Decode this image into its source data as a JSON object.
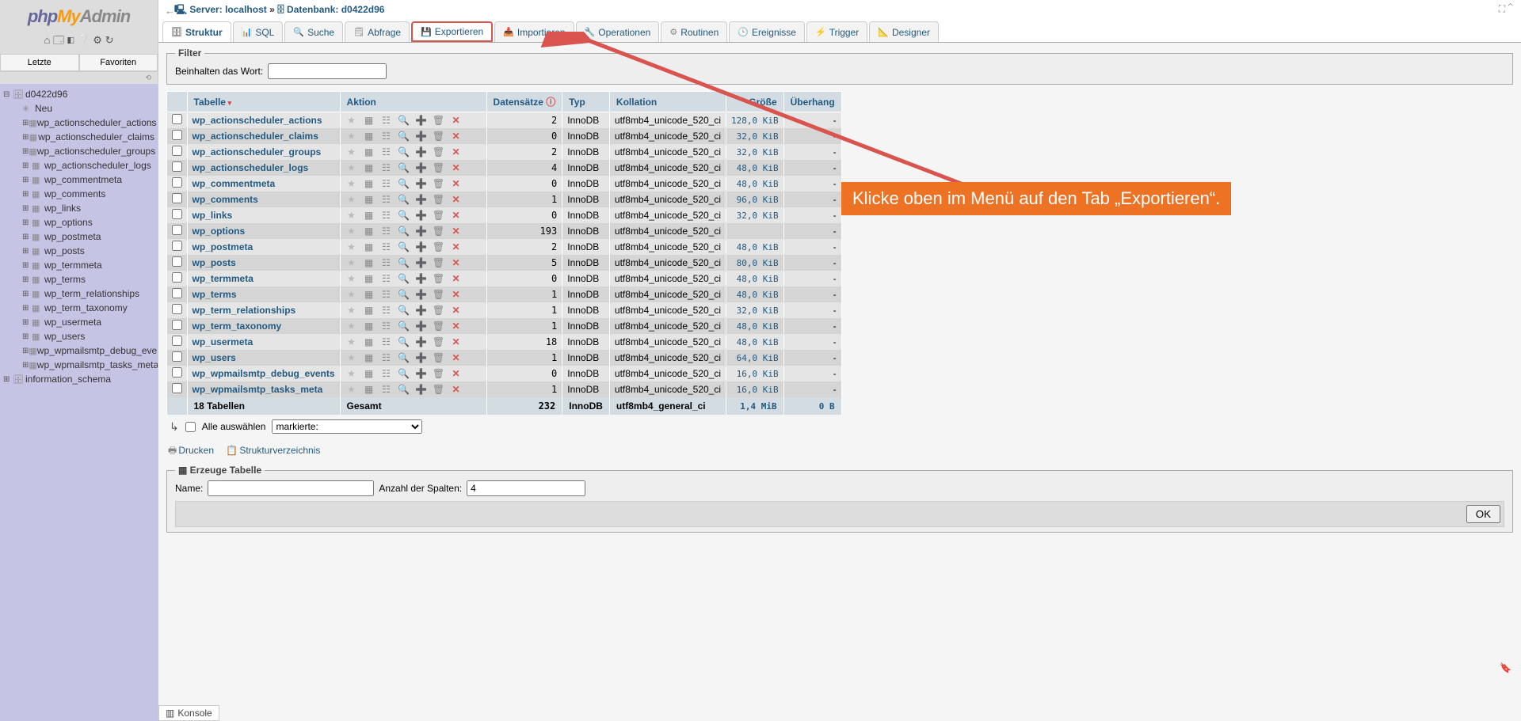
{
  "logo": {
    "p1": "php",
    "p2": "My",
    "p3": "Admin"
  },
  "sidebar_tabs": {
    "recent": "Letzte",
    "favorites": "Favoriten"
  },
  "tree": {
    "db": "d0422d96",
    "new": "Neu",
    "tables": [
      "wp_actionscheduler_actions",
      "wp_actionscheduler_claims",
      "wp_actionscheduler_groups",
      "wp_actionscheduler_logs",
      "wp_commentmeta",
      "wp_comments",
      "wp_links",
      "wp_options",
      "wp_postmeta",
      "wp_posts",
      "wp_termmeta",
      "wp_terms",
      "wp_term_relationships",
      "wp_term_taxonomy",
      "wp_usermeta",
      "wp_users",
      "wp_wpmailsmtp_debug_events",
      "wp_wpmailsmtp_tasks_meta"
    ],
    "info_schema": "information_schema"
  },
  "breadcrumb": {
    "server_label": "Server:",
    "server": "localhost",
    "sep": "»",
    "db_label": "Datenbank:",
    "db": "d0422d96"
  },
  "tabs": [
    "Struktur",
    "SQL",
    "Suche",
    "Abfrage",
    "Exportieren",
    "Importieren",
    "Operationen",
    "Routinen",
    "Ereignisse",
    "Trigger",
    "Designer"
  ],
  "tab_icons": [
    "🗄",
    "📊",
    "🔍",
    "🗒",
    "💾",
    "📥",
    "🔧",
    "⚙",
    "🕒",
    "⚡",
    "📐"
  ],
  "filter": {
    "legend": "Filter",
    "label": "Beinhalten das Wort:"
  },
  "headers": {
    "table": "Tabelle",
    "action": "Aktion",
    "rows": "Datensätze",
    "type": "Typ",
    "collation": "Kollation",
    "size": "Größe",
    "overhead": "Überhang"
  },
  "rows": [
    {
      "t": "wp_actionscheduler_actions",
      "r": "2",
      "e": "InnoDB",
      "c": "utf8mb4_unicode_520_ci",
      "s": "128,0 KiB",
      "o": "-"
    },
    {
      "t": "wp_actionscheduler_claims",
      "r": "0",
      "e": "InnoDB",
      "c": "utf8mb4_unicode_520_ci",
      "s": "32,0 KiB",
      "o": "-"
    },
    {
      "t": "wp_actionscheduler_groups",
      "r": "2",
      "e": "InnoDB",
      "c": "utf8mb4_unicode_520_ci",
      "s": "32,0 KiB",
      "o": "-"
    },
    {
      "t": "wp_actionscheduler_logs",
      "r": "4",
      "e": "InnoDB",
      "c": "utf8mb4_unicode_520_ci",
      "s": "48,0 KiB",
      "o": "-"
    },
    {
      "t": "wp_commentmeta",
      "r": "0",
      "e": "InnoDB",
      "c": "utf8mb4_unicode_520_ci",
      "s": "48,0 KiB",
      "o": "-"
    },
    {
      "t": "wp_comments",
      "r": "1",
      "e": "InnoDB",
      "c": "utf8mb4_unicode_520_ci",
      "s": "96,0 KiB",
      "o": "-"
    },
    {
      "t": "wp_links",
      "r": "0",
      "e": "InnoDB",
      "c": "utf8mb4_unicode_520_ci",
      "s": "32,0 KiB",
      "o": "-"
    },
    {
      "t": "wp_options",
      "r": "193",
      "e": "InnoDB",
      "c": "utf8mb4_unicode_520_ci",
      "s": "",
      "o": "-"
    },
    {
      "t": "wp_postmeta",
      "r": "2",
      "e": "InnoDB",
      "c": "utf8mb4_unicode_520_ci",
      "s": "48,0 KiB",
      "o": "-"
    },
    {
      "t": "wp_posts",
      "r": "5",
      "e": "InnoDB",
      "c": "utf8mb4_unicode_520_ci",
      "s": "80,0 KiB",
      "o": "-"
    },
    {
      "t": "wp_termmeta",
      "r": "0",
      "e": "InnoDB",
      "c": "utf8mb4_unicode_520_ci",
      "s": "48,0 KiB",
      "o": "-"
    },
    {
      "t": "wp_terms",
      "r": "1",
      "e": "InnoDB",
      "c": "utf8mb4_unicode_520_ci",
      "s": "48,0 KiB",
      "o": "-"
    },
    {
      "t": "wp_term_relationships",
      "r": "1",
      "e": "InnoDB",
      "c": "utf8mb4_unicode_520_ci",
      "s": "32,0 KiB",
      "o": "-"
    },
    {
      "t": "wp_term_taxonomy",
      "r": "1",
      "e": "InnoDB",
      "c": "utf8mb4_unicode_520_ci",
      "s": "48,0 KiB",
      "o": "-"
    },
    {
      "t": "wp_usermeta",
      "r": "18",
      "e": "InnoDB",
      "c": "utf8mb4_unicode_520_ci",
      "s": "48,0 KiB",
      "o": "-"
    },
    {
      "t": "wp_users",
      "r": "1",
      "e": "InnoDB",
      "c": "utf8mb4_unicode_520_ci",
      "s": "64,0 KiB",
      "o": "-"
    },
    {
      "t": "wp_wpmailsmtp_debug_events",
      "r": "0",
      "e": "InnoDB",
      "c": "utf8mb4_unicode_520_ci",
      "s": "16,0 KiB",
      "o": "-"
    },
    {
      "t": "wp_wpmailsmtp_tasks_meta",
      "r": "1",
      "e": "InnoDB",
      "c": "utf8mb4_unicode_520_ci",
      "s": "16,0 KiB",
      "o": "-"
    }
  ],
  "summary": {
    "label": "18 Tabellen",
    "total": "Gesamt",
    "rows": "232",
    "engine": "InnoDB",
    "coll": "utf8mb4_general_ci",
    "size": "1,4 MiB",
    "over": "0 B"
  },
  "checkall": {
    "label": "Alle auswählen",
    "select": "markierte:"
  },
  "links": {
    "print": "Drucken",
    "dict": "Strukturverzeichnis"
  },
  "create": {
    "legend": "Erzeuge Tabelle",
    "name": "Name:",
    "cols": "Anzahl der Spalten:",
    "cols_val": "4",
    "ok": "OK"
  },
  "annotation": "Klicke oben im Menü auf den Tab „Exportieren“.",
  "console": "Konsole"
}
